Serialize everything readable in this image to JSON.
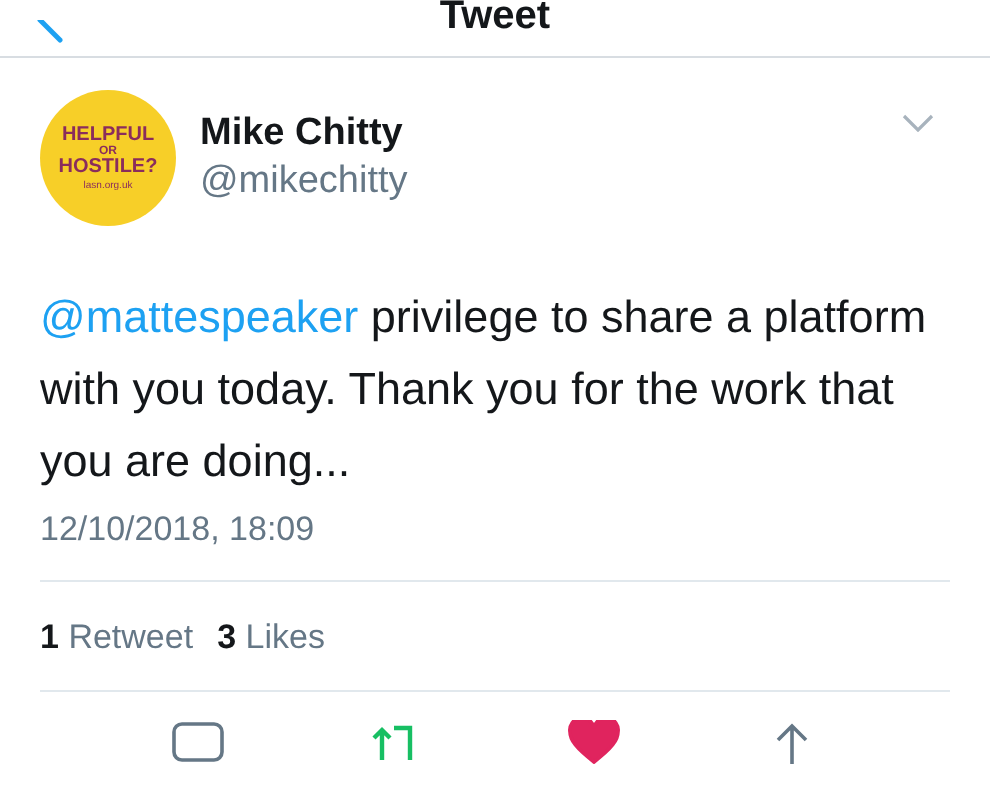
{
  "header": {
    "title": "Tweet"
  },
  "tweet": {
    "avatar": {
      "lines": [
        "HELPFUL",
        "OR",
        "HOSTILE?",
        "lasn.org.uk"
      ]
    },
    "name": "Mike Chitty",
    "handle": "@mikechitty",
    "mention": "@mattespeaker",
    "text": " privilege to share a platform with you today. Thank you for the work that you are doing...",
    "timestamp": "12/10/2018, 18:09"
  },
  "stats": [
    {
      "count": "1",
      "label": "Retweet"
    },
    {
      "count": "3",
      "label": "Likes"
    }
  ],
  "actions": {
    "retweeted": true,
    "liked": true
  }
}
